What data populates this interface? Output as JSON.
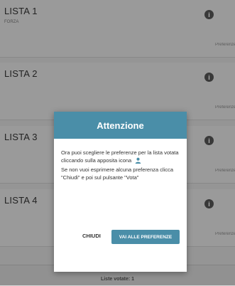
{
  "lists": [
    {
      "title": "LISTA 1",
      "subtitle": "FORZA",
      "pref_label": "Preferenze"
    },
    {
      "title": "LISTA 2",
      "subtitle": "",
      "pref_label": "Preferenze"
    },
    {
      "title": "LISTA 3",
      "subtitle": "",
      "pref_label": "Preferenze"
    },
    {
      "title": "LISTA 4",
      "subtitle": "",
      "pref_label": "Preferenze"
    }
  ],
  "info_glyph": "i",
  "bottom": {
    "text": "Liste votate: 1"
  },
  "modal": {
    "title": "Attenzione",
    "body_line1": "Ora puoi scegliere le preferenze per la lista votata cliccando sulla apposita icona",
    "body_line2": "Se non vuoi esprimere alcuna preferenza clicca \"Chiudi\" e poi sul pulsante \"Vota\"",
    "close_label": "CHIUDI",
    "go_label": "VAI ALLE PREFERENZE"
  },
  "colors": {
    "accent": "#4a8ea8"
  },
  "icons": {
    "info": "info-icon",
    "person": "person-icon"
  }
}
